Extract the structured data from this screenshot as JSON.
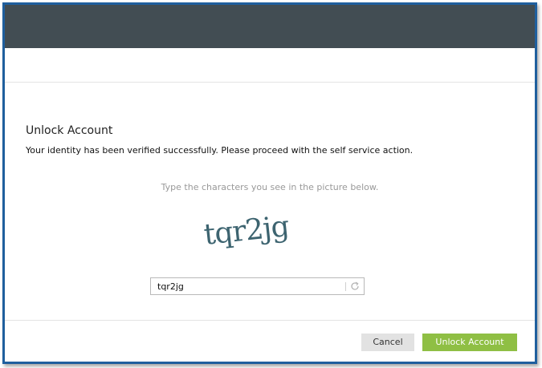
{
  "header": {
    "bar_color": "#424d53"
  },
  "dialog": {
    "title": "Unlock Account",
    "message": "Your identity has been verified successfully. Please proceed with the self service action."
  },
  "captcha": {
    "hint": "Type the characters you see in the picture below.",
    "image_text": "tqr2jg",
    "input_value": "tqr2jg",
    "refresh_icon": "refresh-icon"
  },
  "footer": {
    "cancel_label": "Cancel",
    "unlock_label": "Unlock Account",
    "unlock_color": "#8fbf44"
  }
}
